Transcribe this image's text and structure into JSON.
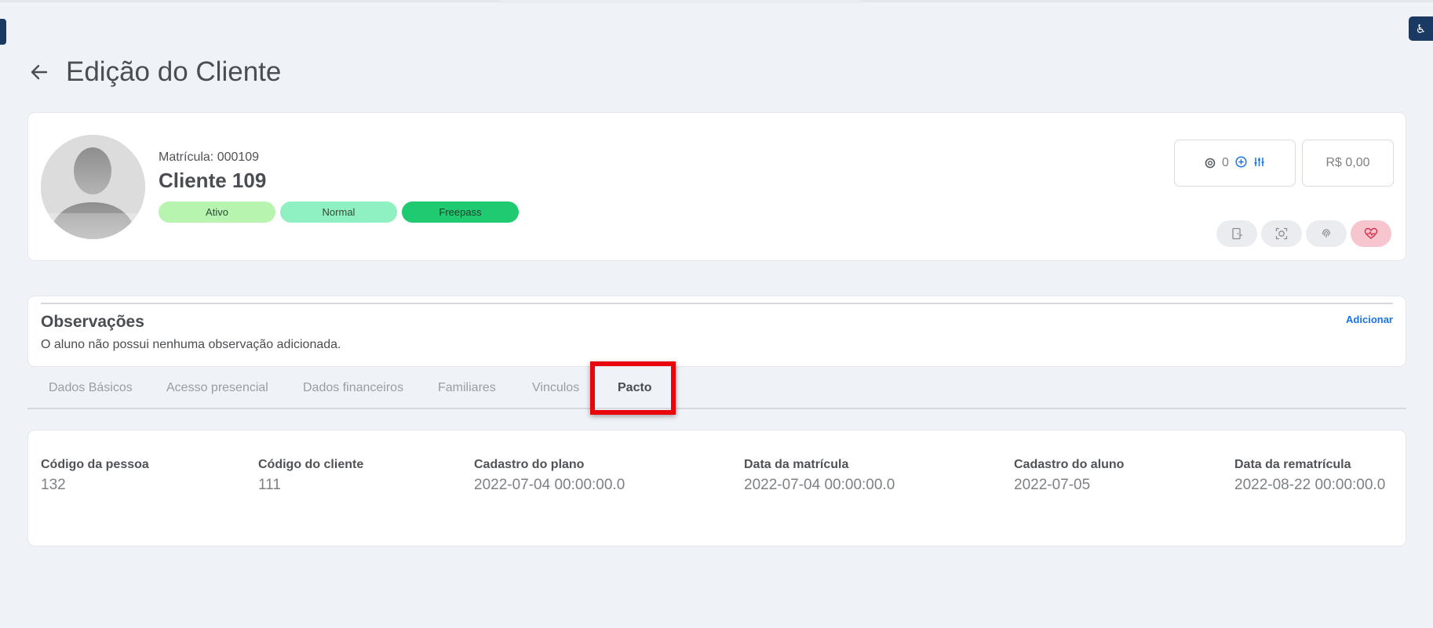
{
  "page": {
    "title": "Edição do Cliente"
  },
  "profile": {
    "matricula": "Matrícula: 000109",
    "name": "Cliente 109",
    "badges": [
      "Ativo",
      "Normal",
      "Freepass"
    ],
    "points": "0",
    "balance": "R$ 0,00"
  },
  "colors": {
    "accent": "#1a73e8",
    "dark_blue": "#1b3a63",
    "highlight": "#e8060a",
    "ativo": "#b6f4b0",
    "normal": "#8ff0c1",
    "freepass": "#1fca71"
  },
  "observations": {
    "title": "Observações",
    "add_label": "Adicionar",
    "text": "O aluno não possui nenhuma observação adicionada."
  },
  "tabs": [
    "Dados Básicos",
    "Acesso presencial",
    "Dados financeiros",
    "Familiares",
    "Vinculos",
    "Pacto"
  ],
  "active_tab": "Pacto",
  "info": [
    {
      "label": "Código da pessoa",
      "value": "132"
    },
    {
      "label": "Código do cliente",
      "value": "111"
    },
    {
      "label": "Cadastro do plano",
      "value": "2022-07-04 00:00:00.0"
    },
    {
      "label": "Data da matrícula",
      "value": "2022-07-04 00:00:00.0"
    },
    {
      "label": "Cadastro do aluno",
      "value": "2022-07-05"
    },
    {
      "label": "Data da rematrícula",
      "value": "2022-08-22 00:00:00.0"
    }
  ]
}
